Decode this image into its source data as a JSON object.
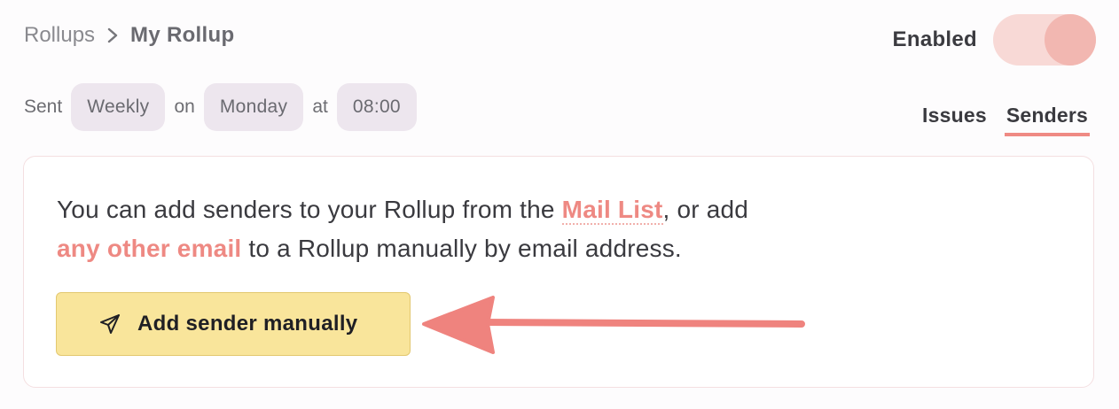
{
  "breadcrumb": {
    "parent": "Rollups",
    "current": "My Rollup",
    "separator_icon": "chevron-right-icon"
  },
  "status": {
    "label": "Enabled",
    "enabled": true,
    "toggle_track_color": "#f8d9d6",
    "toggle_knob_color": "#f2b7b1"
  },
  "schedule": {
    "sent_label": "Sent",
    "frequency": "Weekly",
    "on_label": "on",
    "day": "Monday",
    "at_label": "at",
    "time": "08:00"
  },
  "tabs": [
    {
      "label": "Issues",
      "active": false
    },
    {
      "label": "Senders",
      "active": true
    }
  ],
  "senders_card": {
    "text_part1": "You can add senders to your Rollup from the ",
    "mail_list_link": "Mail List",
    "text_part2": ", or add ",
    "other_email_link": "any other email",
    "text_part3": " to a Rollup manually by email address.",
    "add_button_label": "Add sender manually",
    "add_button_icon": "send-icon"
  },
  "colors": {
    "accent": "#ee8983",
    "button_bg": "#f9e59b",
    "pill_bg": "#ede6ee"
  }
}
